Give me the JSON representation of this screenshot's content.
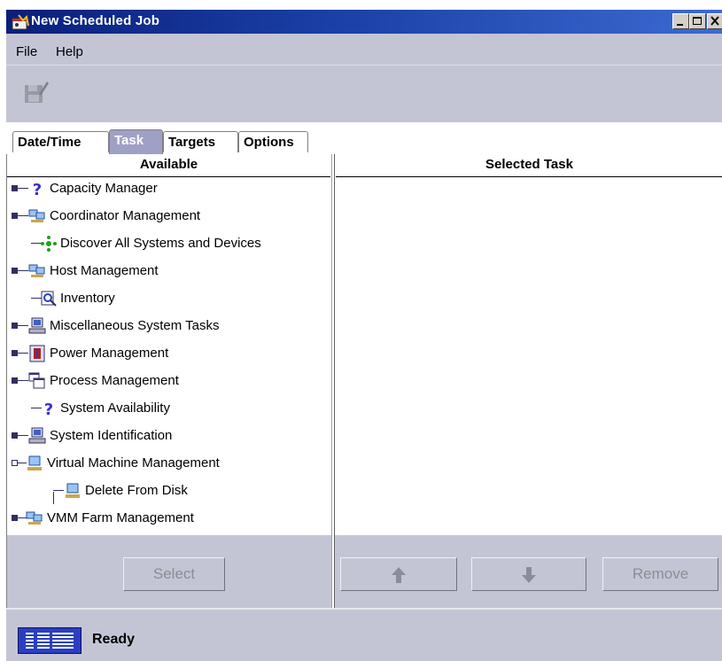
{
  "window": {
    "title": "New Scheduled Job"
  },
  "menu": {
    "file": "File",
    "help": "Help"
  },
  "toolbar": {
    "save_icon": "save-disabled-icon"
  },
  "tabs": [
    {
      "label": "Date/Time",
      "active": false
    },
    {
      "label": "Task",
      "active": true
    },
    {
      "label": "Targets",
      "active": false
    },
    {
      "label": "Options",
      "active": false
    }
  ],
  "columns": {
    "available": "Available",
    "selected": "Selected Task"
  },
  "tree": [
    {
      "label": "Capacity Manager",
      "icon": "question-icon",
      "expandable": true
    },
    {
      "label": "Coordinator Management",
      "icon": "network-computers-icon",
      "expandable": true
    },
    {
      "label": "Discover All Systems and Devices",
      "icon": "discover-icon",
      "expandable": false
    },
    {
      "label": "Host Management",
      "icon": "network-computers-icon",
      "expandable": true
    },
    {
      "label": "Inventory",
      "icon": "inventory-magnifier-icon",
      "expandable": false
    },
    {
      "label": "Miscellaneous System Tasks",
      "icon": "system-computer-icon",
      "expandable": true
    },
    {
      "label": "Power Management",
      "icon": "power-icon",
      "expandable": true
    },
    {
      "label": "Process Management",
      "icon": "windows-icon",
      "expandable": true
    },
    {
      "label": "System Availability",
      "icon": "question-icon",
      "expandable": false
    },
    {
      "label": "System Identification",
      "icon": "system-computer-icon",
      "expandable": true
    },
    {
      "label": "Virtual Machine Management",
      "icon": "virtual-machine-icon",
      "expandable": true,
      "expanded": true
    },
    {
      "label": "Delete From Disk",
      "icon": "virtual-machine-icon",
      "expandable": false,
      "child": true
    },
    {
      "label": "VMM Farm Management",
      "icon": "network-computers-icon",
      "expandable": true
    }
  ],
  "buttons": {
    "select": "Select",
    "move_up_icon": "arrow-up-icon",
    "move_down_icon": "arrow-down-icon",
    "remove": "Remove"
  },
  "status": {
    "logo": "IBM",
    "text": "Ready"
  },
  "colors": {
    "title_bar": "#0a1f7a",
    "panel": "#c4c5d4",
    "active_tab": "#9fa0c6",
    "disabled_text": "#8c8c96"
  }
}
